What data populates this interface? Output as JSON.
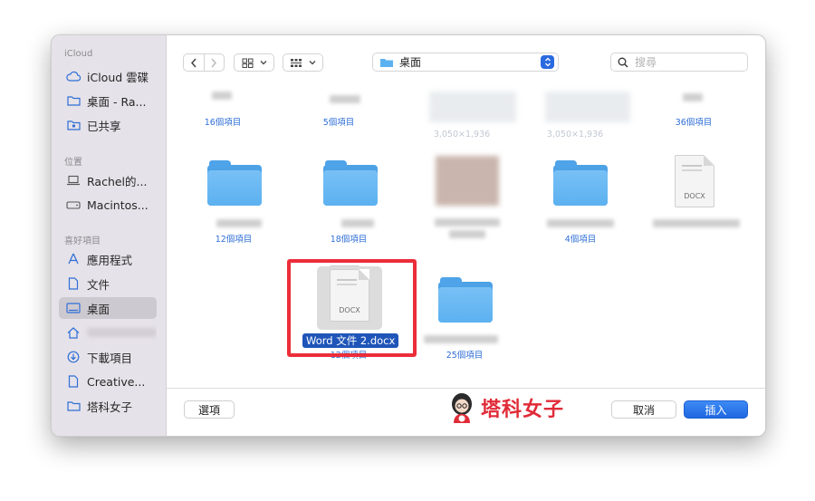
{
  "sidebar": {
    "sections": [
      "iCloud",
      "位置",
      "喜好項目"
    ],
    "items": [
      {
        "label": "iCloud 雲碟",
        "icon": "cloud-icon"
      },
      {
        "label": "桌面 - Ra...",
        "icon": "folder-icon"
      },
      {
        "label": "已共享",
        "icon": "shared-folder-icon"
      },
      {
        "label": "Rachel的...",
        "icon": "laptop-icon"
      },
      {
        "label": "Macintos...",
        "icon": "disk-icon"
      },
      {
        "label": "應用程式",
        "icon": "apps-icon"
      },
      {
        "label": "文件",
        "icon": "document-icon"
      },
      {
        "label": "桌面",
        "icon": "desktop-icon",
        "selected": true
      },
      {
        "label": "",
        "icon": "home-icon"
      },
      {
        "label": "下載項目",
        "icon": "download-icon"
      },
      {
        "label": "Creative...",
        "icon": "file-icon"
      },
      {
        "label": "塔科女子",
        "icon": "folder-icon"
      }
    ]
  },
  "toolbar": {
    "location": "桌面",
    "search_placeholder": "搜尋"
  },
  "grid": {
    "row1": [
      "16個項目",
      "5個項目",
      "3,050×1,936",
      "3,050×1,936",
      "36個項目"
    ],
    "row2": [
      "12個項目",
      "18個項目",
      "",
      "4個項目",
      "DOCX"
    ],
    "row3": [
      "DOCX",
      "12個項目",
      "25個項目"
    ],
    "selected_file": "Word 文件 2.docx"
  },
  "footer": {
    "options_label": "選項",
    "watermark": "塔科女子",
    "cancel_label": "取消",
    "insert_label": "插入"
  },
  "colors": {
    "accent": "#1f67e0",
    "highlight": "#ec2d3a",
    "folder": "#5cb1f0"
  }
}
